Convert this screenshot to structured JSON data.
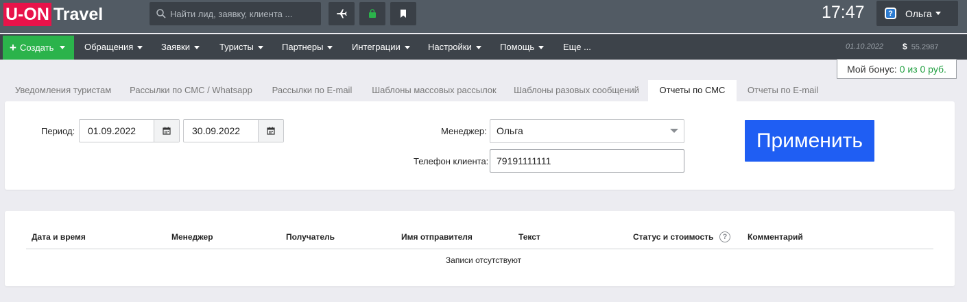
{
  "app": {
    "logo_part1": "U-ON",
    "logo_part2": "Travel",
    "brand_color": "#e8134a"
  },
  "search": {
    "placeholder": "Найти лид, заявку, клиента ..."
  },
  "header": {
    "clock": "17:47",
    "user_name": "Ольга",
    "help_icon_text": "?"
  },
  "nav": {
    "create_label": "Создать",
    "items": [
      "Обращения",
      "Заявки",
      "Туристы",
      "Партнеры",
      "Интеграции",
      "Настройки",
      "Помощь",
      "Еще ..."
    ],
    "date": "01.10.2022",
    "currency_symbol": "$",
    "rate": "55.2987"
  },
  "bonus": {
    "label": "Мой бонус:",
    "value": "0 из 0 руб."
  },
  "tabs": [
    {
      "label": "Уведомления туристам",
      "active": false
    },
    {
      "label": "Рассылки по СМС / Whatsapp",
      "active": false
    },
    {
      "label": "Рассылки по E-mail",
      "active": false
    },
    {
      "label": "Шаблоны массовых рассылок",
      "active": false
    },
    {
      "label": "Шаблоны разовых сообщений",
      "active": false
    },
    {
      "label": "Отчеты по СМС",
      "active": true
    },
    {
      "label": "Отчеты по E-mail",
      "active": false
    }
  ],
  "filter": {
    "period_label": "Период:",
    "date_from": "01.09.2022",
    "date_to": "30.09.2022",
    "manager_label": "Менеджер:",
    "manager_value": "Ольга",
    "phone_label": "Телефон клиента:",
    "phone_value": "79191111111",
    "apply_label": "Применить"
  },
  "table": {
    "columns": [
      "Дата и время",
      "Менеджер",
      "Получатель",
      "Имя отправителя",
      "Текст",
      "Статус и стоимость",
      "Комментарий"
    ],
    "empty_text": "Записи отсутствуют",
    "status_help_icon": "?"
  }
}
